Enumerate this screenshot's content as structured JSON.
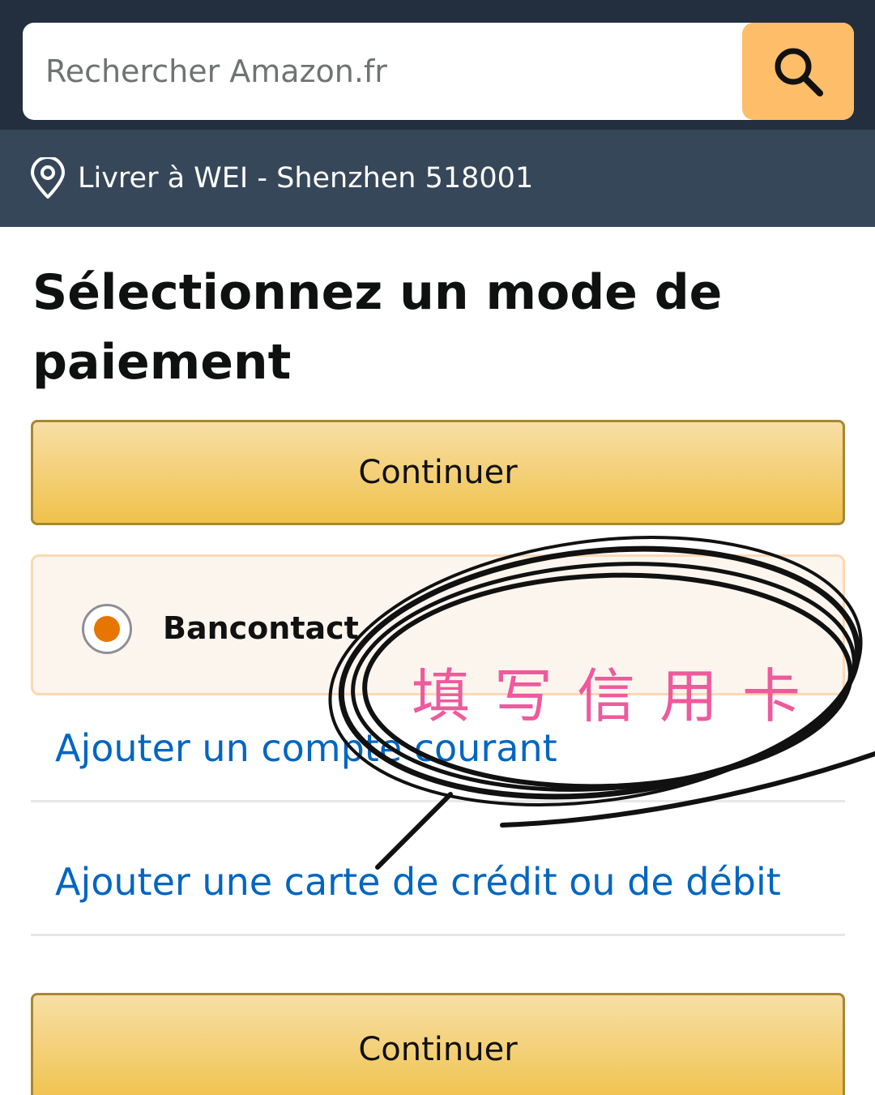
{
  "search": {
    "placeholder": "Rechercher Amazon.fr",
    "button_icon": "search-icon"
  },
  "delivery": {
    "icon": "location-pin-icon",
    "text": "Livrer à WEI - Shenzhen 518001"
  },
  "page": {
    "title": "Sélectionnez un mode de paiement"
  },
  "buttons": {
    "continue_top": "Continuer",
    "continue_bottom": "Continuer"
  },
  "payment_options": [
    {
      "label": "Bancontact",
      "selected": true
    }
  ],
  "links": {
    "add_checking_account": "Ajouter un compte courant",
    "add_card": "Ajouter une carte de crédit ou de débit"
  },
  "annotation": {
    "text": "填写信用卡",
    "color": "#ee5a9c"
  },
  "colors": {
    "header_bg": "#232f3e",
    "delivery_bg": "#37475a",
    "search_button": "#febd69",
    "button_yellow": "#f0c14b",
    "link_blue": "#0066c0",
    "radio_orange": "#e77600"
  }
}
